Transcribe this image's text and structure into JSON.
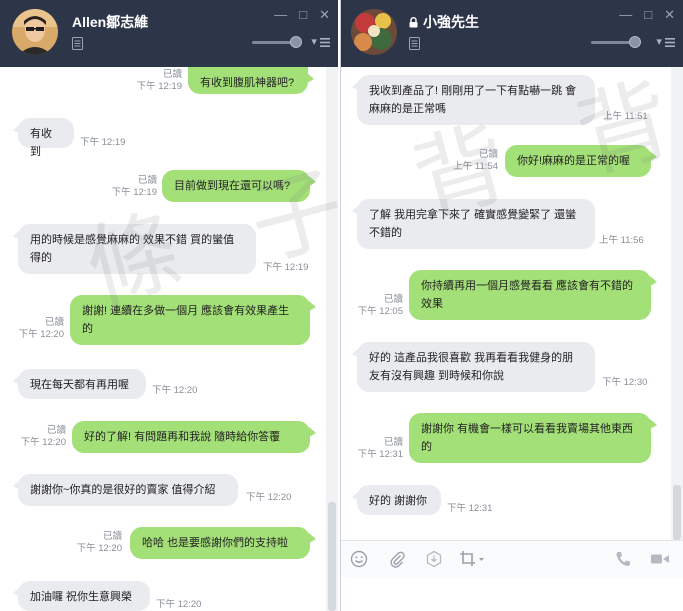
{
  "left": {
    "title": "Allen鄒志維",
    "messages": [
      {
        "dir": "out",
        "text": "有收到腹肌神器吧?",
        "read": "已讀",
        "time": "下午 12:19"
      },
      {
        "dir": "in",
        "text": "有收到",
        "time": "下午 12:19"
      },
      {
        "dir": "out",
        "text": "目前做到現在還可以嗎?",
        "read": "已讀",
        "time": "下午 12:19"
      },
      {
        "dir": "in",
        "text": "用的時候是感覺麻麻的 效果不錯 買的蠻值得的",
        "time": "下午 12:19"
      },
      {
        "dir": "out",
        "text": "謝謝! 連續在多做一個月 應該會有效果產生的",
        "read": "已讀",
        "time": "下午 12:20"
      },
      {
        "dir": "in",
        "text": "現在每天都有再用喔",
        "time": "下午 12:20"
      },
      {
        "dir": "out",
        "text": "好的了解! 有問題再和我說 隨時給你答覆",
        "read": "已讀",
        "time": "下午 12:20"
      },
      {
        "dir": "in",
        "text": "謝謝你~你真的是很好的賣家 值得介紹",
        "time": "下午 12:20"
      },
      {
        "dir": "out",
        "text": "哈哈 也是要感謝你們的支持啦",
        "read": "已讀",
        "time": "下午 12:20"
      },
      {
        "dir": "in",
        "text": "加油囉 祝你生意興榮",
        "time": "下午 12:20"
      }
    ]
  },
  "right": {
    "title": "小強先生",
    "messages": [
      {
        "dir": "in",
        "text": "我收到產品了! 剛剛用了一下有點嚇一跳 會麻麻的是正常嗎",
        "time": "上午 11:51"
      },
      {
        "dir": "out",
        "text": "你好!麻麻的是正常的喔",
        "read": "已讀",
        "time": "上午 11:54"
      },
      {
        "dir": "in",
        "text": "了解 我用完拿下來了 確實感覺變緊了 還蠻不錯的",
        "time": "上午 11:56"
      },
      {
        "dir": "out",
        "text": "你持續再用一個月感覺看看 應該會有不錯的效果",
        "read": "已讀",
        "time": "下午 12:05"
      },
      {
        "dir": "in",
        "text": "好的 這產品我很喜歡 我再看看我健身的朋友有沒有興趣 到時候和你說",
        "time": "下午 12:30"
      },
      {
        "dir": "out",
        "text": "謝謝你 有機會一樣可以看看我賣場其他東西的",
        "read": "已讀",
        "time": "下午 12:31"
      },
      {
        "dir": "in",
        "text": "好的 謝謝你",
        "time": "下午 12:31"
      }
    ]
  },
  "watermark": "條 子 背 背",
  "colors": {
    "titlebar": "#2d3649",
    "bubble_out": "#a4e078",
    "bubble_in": "#e9ebef"
  }
}
